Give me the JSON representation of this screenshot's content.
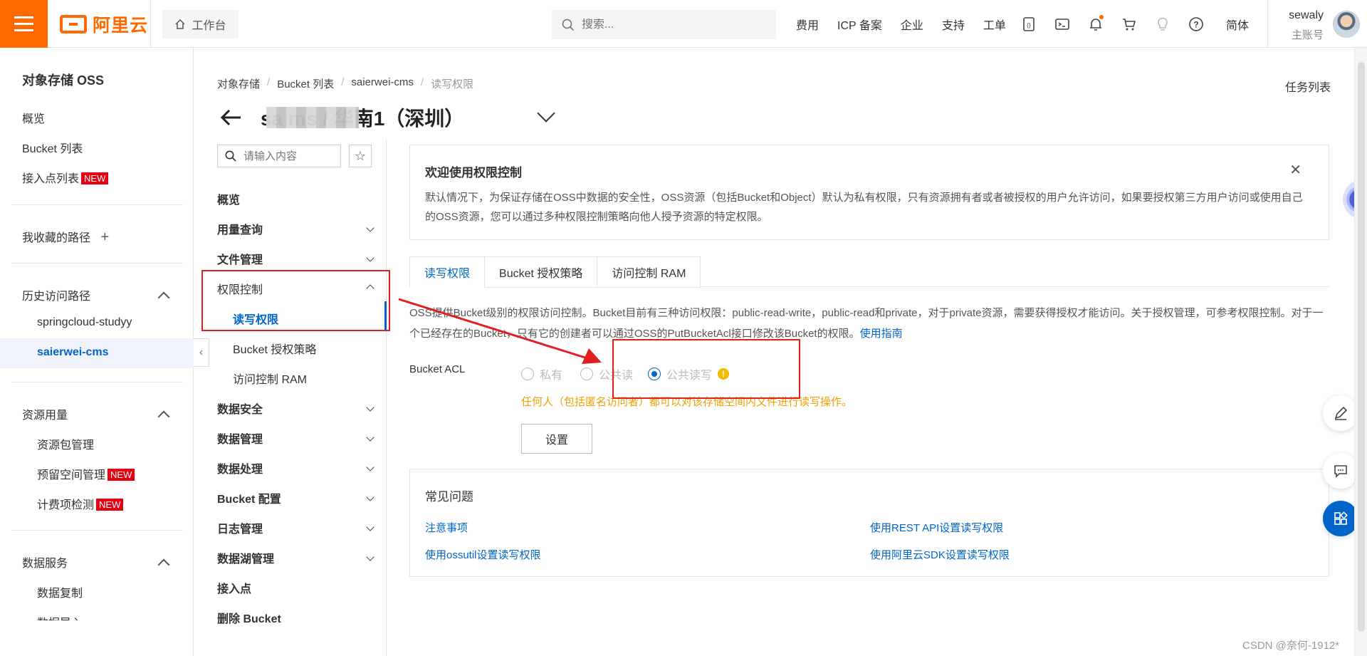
{
  "topbar": {
    "logo_text": "阿里云",
    "workbench": "工作台",
    "search_placeholder": "搜索...",
    "links": [
      "费用",
      "ICP 备案",
      "企业",
      "支持",
      "工单"
    ],
    "language": "简体",
    "username": "sewaly",
    "account_type": "主账号",
    "accent_color": "#ff6a00"
  },
  "sidebar": {
    "title": "对象存储 OSS",
    "items": [
      {
        "label": "概览"
      },
      {
        "label": "Bucket 列表"
      },
      {
        "label": "接入点列表",
        "badge": "NEW"
      }
    ],
    "favorites": "我收藏的路径",
    "history_title": "历史访问路径",
    "history_items": [
      "springcloud-studyy",
      "saierwei-cms"
    ],
    "resources_title": "资源用量",
    "resources_items": [
      {
        "label": "资源包管理"
      },
      {
        "label": "预留空间管理",
        "badge": "NEW"
      },
      {
        "label": "计费项检测",
        "badge": "NEW"
      }
    ],
    "data_services_title": "数据服务",
    "data_services_items": [
      "数据复制",
      "数据导入"
    ]
  },
  "breadcrumb": [
    "对象存储",
    "Bucket 列表",
    "saierwei-cms",
    "读写权限"
  ],
  "task_list": "任务列表",
  "page_title": "sa           ms / 华南1（深圳）",
  "subnav": {
    "search_placeholder": "请输入内容",
    "items": {
      "overview": "概览",
      "usage": "用量查询",
      "files": "文件管理",
      "access": "权限控制",
      "access_rw": "读写权限",
      "access_policy": "Bucket 授权策略",
      "access_ram": "访问控制 RAM",
      "security": "数据安全",
      "data_mgmt": "数据管理",
      "processing": "数据处理",
      "bucket_config": "Bucket 配置",
      "logs": "日志管理",
      "lake": "数据湖管理",
      "endpoint": "接入点",
      "delete": "删除 Bucket"
    }
  },
  "welcome": {
    "title": "欢迎使用权限控制",
    "body": "默认情况下，为保证存储在OSS中数据的安全性，OSS资源（包括Bucket和Object）默认为私有权限，只有资源拥有者或者被授权的用户允许访问，如果要授权第三方用户访问或使用自己的OSS资源，您可以通过多种权限控制策略向他人授予资源的特定权限。"
  },
  "tabs": [
    "读写权限",
    "Bucket 授权策略",
    "访问控制 RAM"
  ],
  "description": "OSS提供Bucket级别的权限访问控制。Bucket目前有三种访问权限：public-read-write，public-read和private，对于private资源，需要获得授权才能访问。关于授权管理，可参考权限控制。对于一个已经存在的Bucket，只有它的创建者可以通过OSS的PutBucketAcl接口修改该Bucket的权限。",
  "description_link": "使用指南",
  "acl": {
    "label": "Bucket ACL",
    "options": [
      "私有",
      "公共读",
      "公共读写"
    ],
    "selected": "公共读写",
    "warning": "任何人（包括匿名访问者）都可以对该存储空间内文件进行读写操作。",
    "set_button": "设置"
  },
  "faq": {
    "title": "常见问题",
    "links": [
      "注意事项",
      "使用REST API设置读写权限",
      "使用ossutil设置读写权限",
      "使用阿里云SDK设置读写权限"
    ]
  },
  "watermark": "CSDN @奈何-1912*"
}
